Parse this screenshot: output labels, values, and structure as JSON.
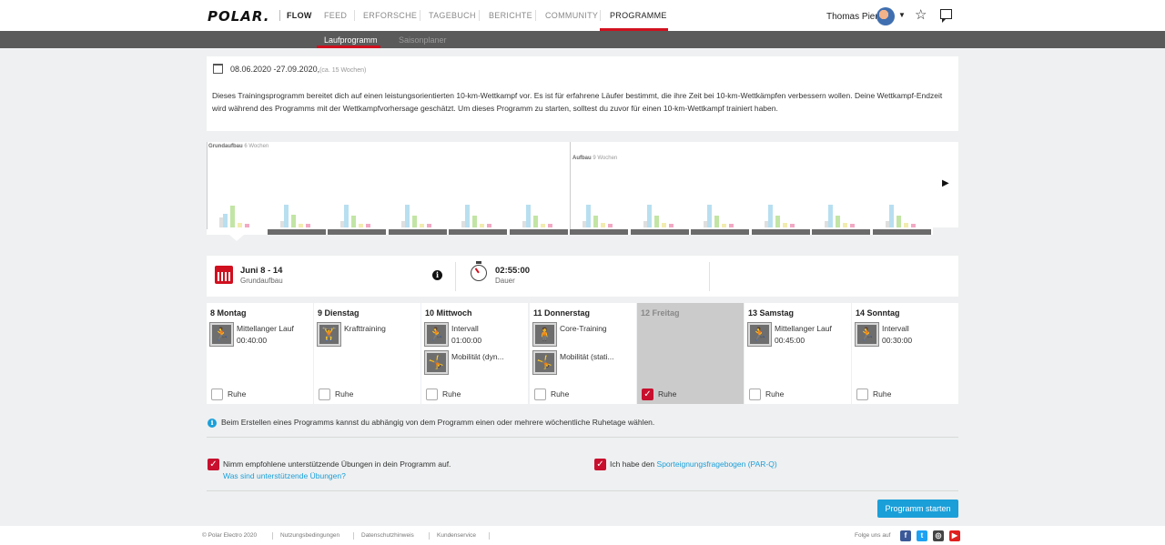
{
  "nav": {
    "logo": "POLAR.",
    "flow": "FLOW",
    "items": [
      "FEED",
      "ERFORSCHE",
      "TAGEBUCH",
      "BERICHTE",
      "COMMUNITY",
      "PROGRAMME"
    ],
    "user": "Thomas Pier"
  },
  "subnav": {
    "active": "Laufprogramm",
    "inactive": "Saisonplaner"
  },
  "program": {
    "dates": "08.06.2020 -27.09.2020,",
    "weeks": "(ca. 15 Wochen)",
    "description": "Dieses Trainingsprogramm bereitet dich auf einen leistungsorientierten 10-km-Wettkampf vor. Es ist für erfahrene Läufer bestimmt, die ihre Zeit bei 10-km-Wettkämpfen verbessern wollen. Deine Wettkampf-Endzeit wird während des Programms mit der Wettkampfvorhersage geschätzt. Um dieses Programm zu starten, solltest du zuvor für einen 10-km-Wettkampf trainiert haben."
  },
  "chart": {
    "phases": [
      {
        "name": "Grundaufbau",
        "weeks": "6 Wochen"
      },
      {
        "name": "Aufbau",
        "weeks": "9 Wochen"
      }
    ],
    "week_count": 12,
    "selected_week": 0,
    "bar_colors": [
      "#dfdfdf",
      "#b8dff0",
      "#c2e5a5",
      "#f2ecae",
      "#f2a9c4"
    ],
    "week_bars": [
      [
        0.3,
        0.4,
        0.62,
        0.12,
        0.1
      ],
      [
        0.18,
        0.65,
        0.38,
        0.1,
        0.1
      ],
      [
        0.18,
        0.65,
        0.35,
        0.1,
        0.1
      ],
      [
        0.18,
        0.65,
        0.35,
        0.1,
        0.1
      ],
      [
        0.18,
        0.65,
        0.35,
        0.1,
        0.1
      ],
      [
        0.18,
        0.65,
        0.35,
        0.1,
        0.1
      ],
      [
        0.18,
        0.65,
        0.35,
        0.12,
        0.1
      ],
      [
        0.18,
        0.65,
        0.35,
        0.12,
        0.1
      ],
      [
        0.18,
        0.65,
        0.35,
        0.1,
        0.1
      ],
      [
        0.18,
        0.65,
        0.35,
        0.12,
        0.1
      ],
      [
        0.18,
        0.65,
        0.35,
        0.12,
        0.1
      ],
      [
        0.18,
        0.65,
        0.35,
        0.12,
        0.1
      ]
    ]
  },
  "week": {
    "title": "Juni 8 - 14",
    "phase": "Grundaufbau",
    "duration": "02:55:00",
    "duration_label": "Dauer"
  },
  "days": [
    {
      "label": "8  Montag",
      "rest": false,
      "exercises": [
        {
          "icon": "running-icon",
          "name": "Mittellanger Lauf",
          "dur": "00:40:00"
        }
      ]
    },
    {
      "label": "9  Dienstag",
      "rest": false,
      "exercises": [
        {
          "icon": "strength-icon",
          "name": "Krafttraining",
          "dur": ""
        }
      ]
    },
    {
      "label": "10 Mittwoch",
      "rest": false,
      "exercises": [
        {
          "icon": "running-icon",
          "name": "Intervall",
          "dur": "01:00:00"
        },
        {
          "icon": "mobility-icon",
          "name": "Mobilität (dyn...",
          "dur": ""
        }
      ]
    },
    {
      "label": "11 Donnerstag",
      "rest": false,
      "exercises": [
        {
          "icon": "core-icon",
          "name": "Core-Training",
          "dur": ""
        },
        {
          "icon": "mobility-icon",
          "name": "Mobilität (stati...",
          "dur": ""
        }
      ]
    },
    {
      "label": "12 Freitag",
      "rest": true,
      "exercises": []
    },
    {
      "label": "13 Samstag",
      "rest": false,
      "exercises": [
        {
          "icon": "running-icon",
          "name": "Mittellanger Lauf",
          "dur": "00:45:00"
        }
      ]
    },
    {
      "label": "14 Sonntag",
      "rest": false,
      "exercises": [
        {
          "icon": "running-icon",
          "name": "Intervall",
          "dur": "00:30:00"
        }
      ]
    }
  ],
  "rest_label": "Ruhe",
  "note": "Beim Erstellen eines Programms kannst du abhängig von dem Programm einen oder mehrere wöchentliche Ruhetage wählen.",
  "options": {
    "supportive": "Nimm empfohlene unterstützende Übungen in dein Programm auf.",
    "supportive_link": "Was sind unterstützende Übungen?",
    "parq_prefix": "Ich habe den",
    "parq_link": "Sporteignungsfragebogen (PAR-Q)"
  },
  "start_button": "Programm starten",
  "footer": {
    "copyright": "© Polar Electro 2020",
    "links": [
      "Nutzungsbedingungen",
      "Datenschutzhinweis",
      "Kundenservice"
    ],
    "follow": "Folge uns auf"
  }
}
